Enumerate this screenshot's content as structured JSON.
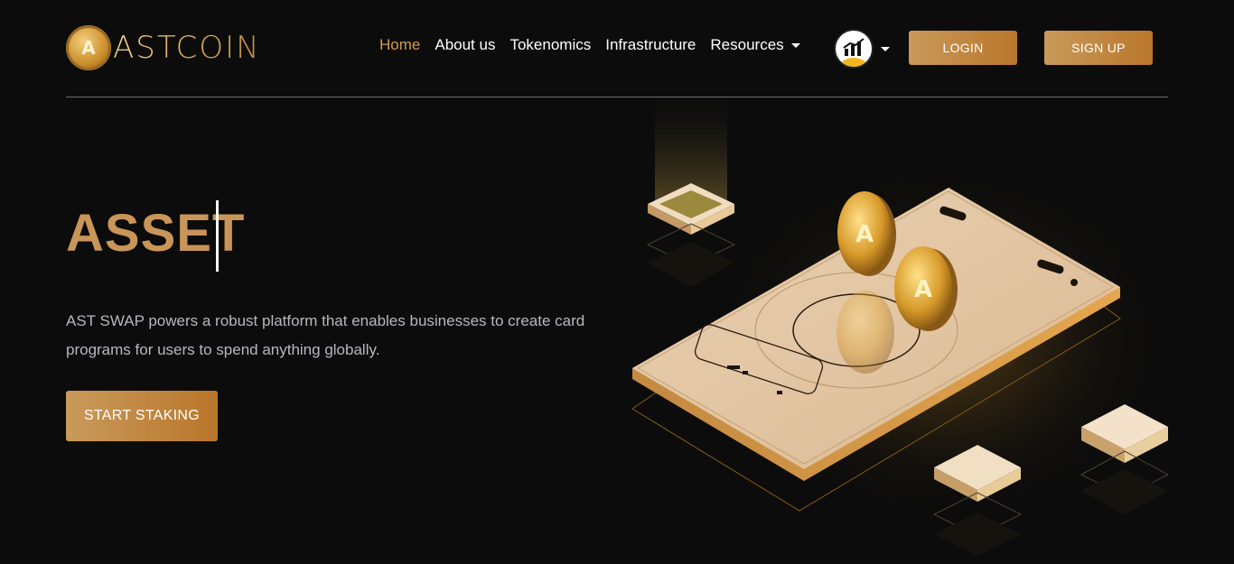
{
  "brand": {
    "logo_letter": "A",
    "name": "ASTCOIN"
  },
  "nav": {
    "items": [
      {
        "label": "Home",
        "active": true
      },
      {
        "label": "About us"
      },
      {
        "label": "Tokenomics"
      },
      {
        "label": "Infrastructure"
      },
      {
        "label": "Resources",
        "dropdown": true
      }
    ],
    "chart_icon": "chart-growth-icon"
  },
  "auth": {
    "login_label": "LOGIN",
    "signup_label": "SIGN UP"
  },
  "hero": {
    "title": "ASSET",
    "description": "AST SWAP powers a robust platform that enables businesses to create card programs for users to spend anything globally.",
    "cta_label": "START STAKING"
  },
  "colors": {
    "accent": "#c99558",
    "background": "#0c0c0c",
    "button_from": "#c99a5b",
    "button_to": "#b9762a",
    "active_nav": "#d49a50"
  }
}
